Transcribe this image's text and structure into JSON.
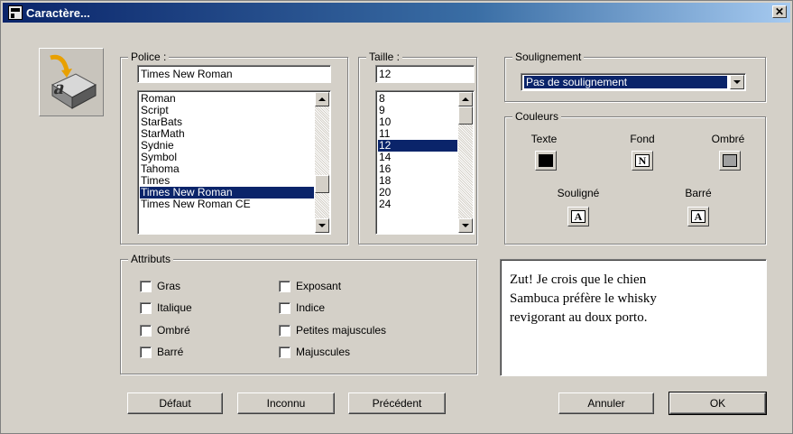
{
  "window": {
    "title": "Caractère...",
    "close_glyph": "✕"
  },
  "police": {
    "legend": "Police :",
    "value": "Times New Roman",
    "items": [
      "Roman",
      "Script",
      "StarBats",
      "StarMath",
      "Sydnie",
      "Symbol",
      "Tahoma",
      "Times",
      "Times New Roman",
      "Times New Roman CE"
    ],
    "selected": "Times New Roman"
  },
  "taille": {
    "legend": "Taille :",
    "value": "12",
    "items": [
      "8",
      "9",
      "10",
      "11",
      "12",
      "14",
      "16",
      "18",
      "20",
      "24"
    ],
    "selected": "12"
  },
  "soulignement": {
    "legend": "Soulignement",
    "value": "Pas de soulignement"
  },
  "couleurs": {
    "legend": "Couleurs",
    "texte": {
      "label": "Texte",
      "color": "#000000"
    },
    "fond": {
      "label": "Fond",
      "glyph": "N"
    },
    "ombre": {
      "label": "Ombré",
      "color": "#a0a0a0"
    },
    "souligne": {
      "label": "Souligné",
      "glyph": "A"
    },
    "barre": {
      "label": "Barré",
      "glyph": "A"
    }
  },
  "attributs": {
    "legend": "Attributs",
    "gras": "Gras",
    "italique": "Italique",
    "ombre": "Ombré",
    "barre": "Barré",
    "exposant": "Exposant",
    "indice": "Indice",
    "petites_majuscules": "Petites majuscules",
    "majuscules": "Majuscules"
  },
  "preview": {
    "text": "Zut! Je crois que le chien\nSambuca préfère le whisky\nrevigorant au doux porto."
  },
  "buttons": {
    "defaut": "Défaut",
    "inconnu": "Inconnu",
    "precedent": "Précédent",
    "annuler": "Annuler",
    "ok": "OK"
  },
  "colors": {
    "title_start": "#0a246a",
    "title_end": "#a6caf0",
    "selection": "#0a246a",
    "face": "#d4d0c8"
  }
}
